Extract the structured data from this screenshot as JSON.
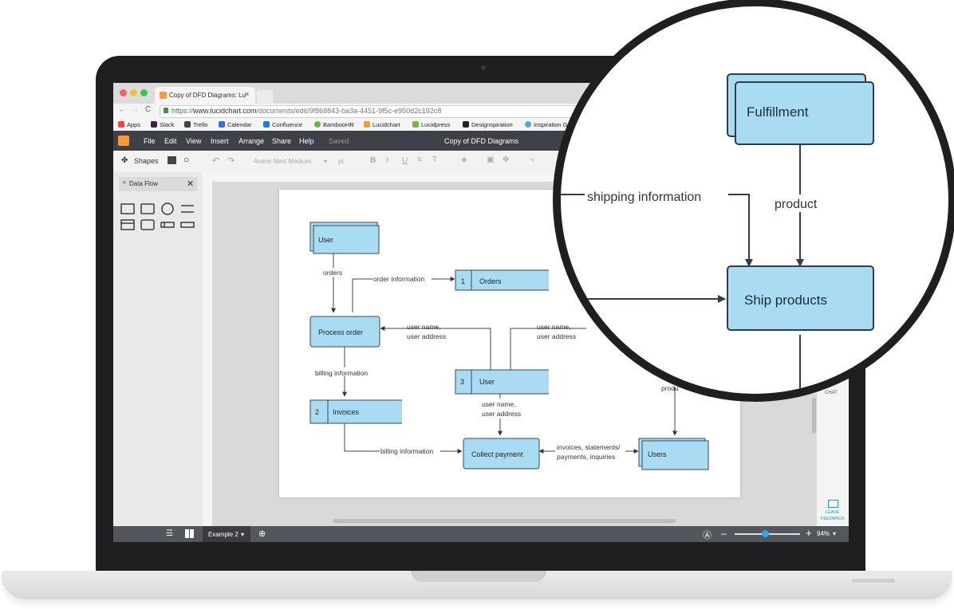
{
  "browser": {
    "tab_title": "Copy of DFD Diagrams: Lu",
    "url_secure": "https://",
    "url_host": "www.lucidchart.com",
    "url_path": "/documents/edit/9f868843-ba3a-4451-9f5c-e950d2c192c8",
    "bookmarks": [
      "Apps",
      "Slack",
      "Trello",
      "Calendar",
      "Confluence",
      "BambooHR",
      "Lucidchart",
      "Lucidpress",
      "Designspiration",
      "Inspiration G"
    ]
  },
  "app": {
    "menu": [
      "File",
      "Edit",
      "View",
      "Insert",
      "Arrange",
      "Share",
      "Help"
    ],
    "saved_status": "Saved",
    "doc_title": "Copy of DFD Diagrams",
    "shapes_label": "Shapes",
    "font_name": "Avenir Next Medium",
    "font_size": "pt",
    "shape_panel_title": "Data Flow",
    "page_tab": "Example 2",
    "zoom": "94%",
    "chat_label": "CHAT",
    "feedback_label_1": "LEAVE",
    "feedback_label_2": "FEEDBACK"
  },
  "diagram": {
    "nodes": {
      "user": "User",
      "orders_num": "1",
      "orders": "Orders",
      "process_order": "Process order",
      "user_store_num": "3",
      "user_store": "User",
      "invoices_num": "2",
      "invoices": "Invoices",
      "collect_payment": "Collect payment",
      "users": "Users"
    },
    "labels": {
      "orders": "orders",
      "order_information": "order information",
      "user_name_1": "user name,",
      "user_address_1": "user address",
      "user_name_2": "user name,",
      "user_address_2": "user address",
      "billing_information_1": "billing information",
      "user_name_3": "user name,",
      "user_address_3": "user address",
      "billing_information_2": "billing information",
      "invoices_1": "invoices, statements/",
      "invoices_2": "payments, inquiries",
      "product_partial": "produ"
    }
  },
  "magnifier": {
    "fulfillment": "Fulfillment",
    "shipping_information": "shipping information",
    "product": "product",
    "ship_products": "Ship products"
  },
  "colors": {
    "node_fill": "#a9dcf3",
    "node_stroke": "#34495e",
    "menubar": "#3f4148",
    "accent": "#f29d38"
  }
}
